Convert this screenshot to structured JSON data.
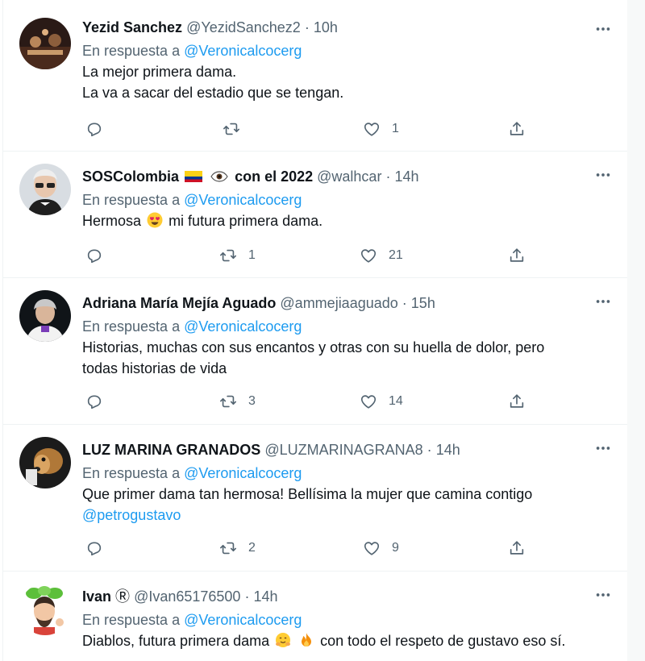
{
  "reply_prefix": "En respuesta a",
  "tweets": [
    {
      "name": "Yezid Sanchez",
      "name_suffix": "",
      "handle": "@YezidSanchez2",
      "time": "10h",
      "reply_to": "@Veronicalcocerg",
      "text_lines": [
        "La mejor primera dama.",
        "La va a sacar del estadio que se tengan."
      ],
      "replies": "",
      "retweets": "",
      "likes": "1"
    },
    {
      "name": "SOSColombia",
      "name_suffix": "con el 2022",
      "handle": "@walhcar",
      "time": "14h",
      "reply_to": "@Veronicalcocerg",
      "text_before_emoji": "Hermosa",
      "text_after_emoji": "mi futura primera dama.",
      "replies": "",
      "retweets": "1",
      "likes": "21"
    },
    {
      "name": "Adriana María Mejía Aguado",
      "name_suffix": "",
      "handle": "@ammejiaaguado",
      "time": "15h",
      "reply_to": "@Veronicalcocerg",
      "text_lines": [
        "Historias, muchas con sus encantos y otras con su huella de dolor, pero",
        "todas historias de vida"
      ],
      "replies": "",
      "retweets": "3",
      "likes": "14"
    },
    {
      "name": "LUZ MARINA GRANADOS",
      "name_suffix": "",
      "handle": "@LUZMARINAGRANA8",
      "time": "14h",
      "reply_to": "@Veronicalcocerg",
      "text_lines": [
        "Que primer dama tan hermosa! Bellísima la mujer que camina contigo"
      ],
      "text_mention": "@petrogustavo",
      "replies": "",
      "retweets": "2",
      "likes": "9"
    },
    {
      "name": "Ivan",
      "name_suffix": "Ⓡ",
      "handle": "@Ivan65176500",
      "time": "14h",
      "reply_to": "@Veronicalcocerg",
      "text_part1": "Diablos, futura primera dama",
      "text_part2": "con todo el respeto de gustavo eso sí.",
      "replies": "",
      "retweets": "",
      "likes": ""
    }
  ],
  "separator": "·",
  "colors": {
    "accent": "#1d9bf0",
    "secondary": "#536471",
    "text": "#0f1419"
  },
  "icons": [
    "reply-icon",
    "retweet-icon",
    "like-icon",
    "share-icon",
    "more-icon",
    "colombia-flag-icon",
    "eye-icon",
    "heart-eyes-emoji",
    "hugging-emoji",
    "fire-emoji"
  ]
}
